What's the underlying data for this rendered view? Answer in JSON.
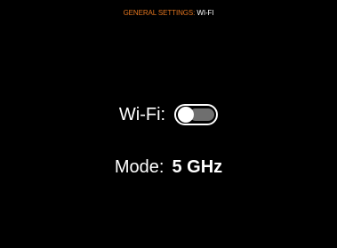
{
  "header": {
    "section": "GENERAL SETTINGS:",
    "page": "WI-FI"
  },
  "settings": {
    "wifi": {
      "label": "Wi-Fi:",
      "enabled": false
    },
    "mode": {
      "label": "Mode:",
      "value": "5 GHz"
    }
  },
  "colors": {
    "background": "#000000",
    "accent": "#e0741f",
    "text": "#ffffff",
    "toggle_off_track": "#6f6f6f"
  }
}
